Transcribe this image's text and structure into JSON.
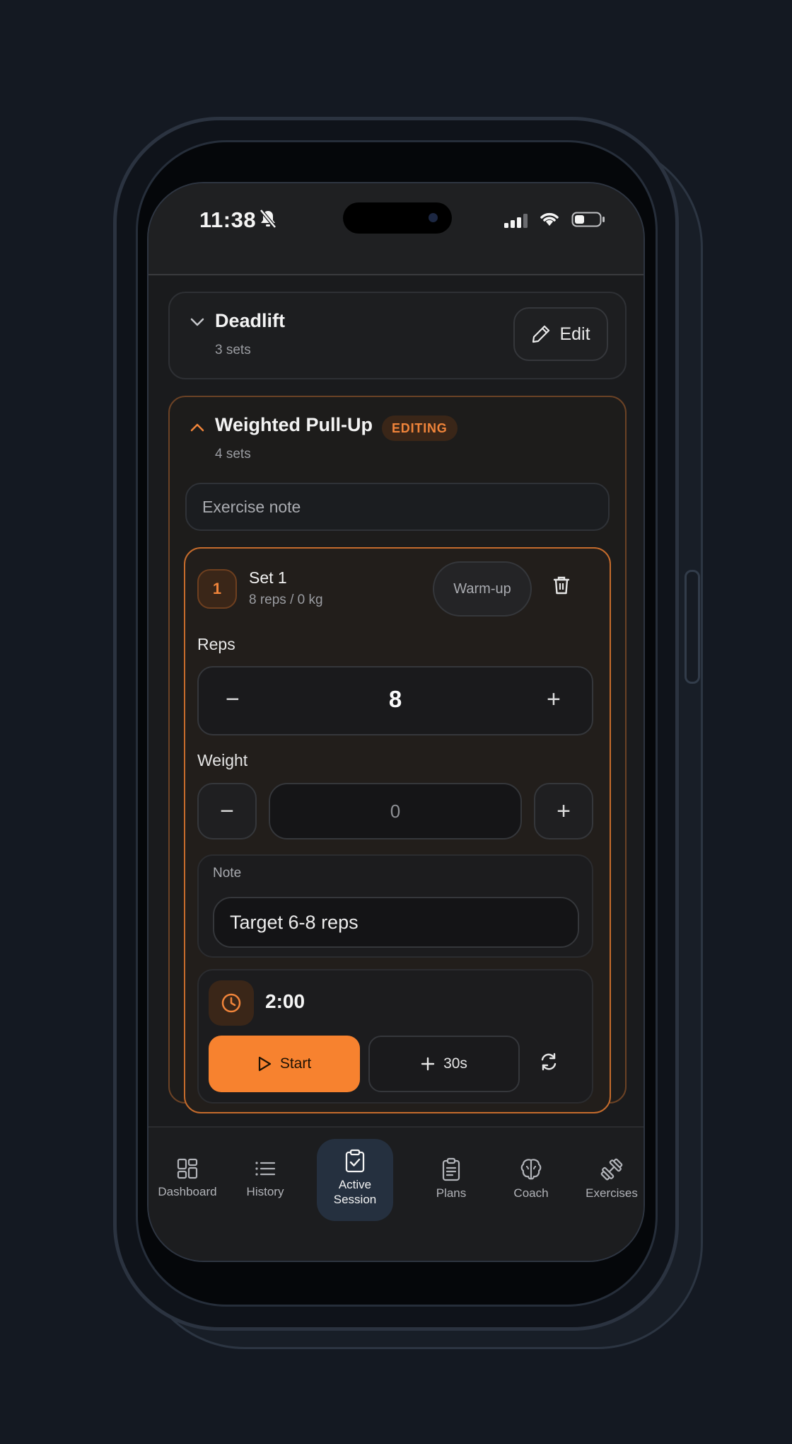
{
  "status_bar": {
    "time": "11:38"
  },
  "exercises": [
    {
      "name": "Deadlift",
      "sets": "3 sets",
      "edit_label": "Edit"
    },
    {
      "name": "Weighted Pull-Up",
      "sets": "4 sets",
      "badge": "EDITING",
      "note_placeholder": "Exercise note",
      "set": {
        "number": "1",
        "title": "Set 1",
        "summary": "8 reps / 0 kg",
        "warmup_label": "Warm-up",
        "reps_label": "Reps",
        "reps_value": "8",
        "weight_label": "Weight",
        "weight_value": "0",
        "note_label": "Note",
        "note_value": "Target 6-8 reps",
        "timer_value": "2:00",
        "start_label": "Start",
        "add_label": "30s",
        "minus_symbol": "−",
        "plus_symbol": "+"
      }
    }
  ],
  "nav": {
    "items": [
      {
        "label": "Dashboard",
        "icon": "dashboard-icon"
      },
      {
        "label": "History",
        "icon": "list-icon"
      },
      {
        "label": "Active Session",
        "icon": "clipboard-check-icon",
        "active": true
      },
      {
        "label": "Plans",
        "icon": "clipboard-list-icon"
      },
      {
        "label": "Coach",
        "icon": "brain-icon"
      },
      {
        "label": "Exercises",
        "icon": "dumbbell-icon"
      }
    ]
  },
  "colors": {
    "accent": "#f7822f",
    "background": "#1a1b1d",
    "active_nav": "#25303f"
  }
}
